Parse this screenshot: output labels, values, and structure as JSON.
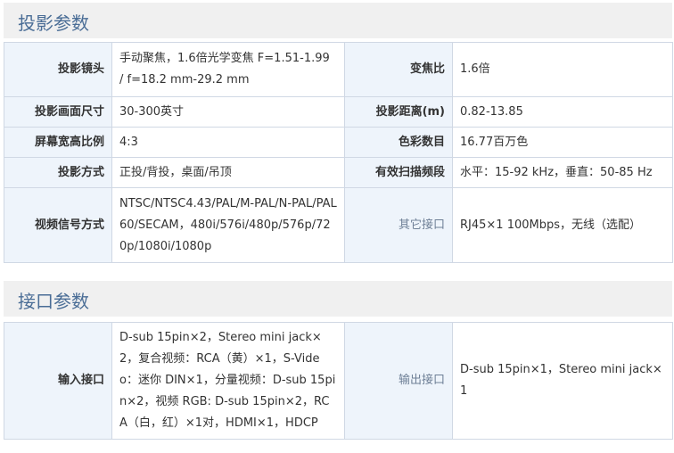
{
  "sections": [
    {
      "title": "投影参数",
      "rows": [
        [
          {
            "label": "投影镜头",
            "value": "手动聚焦，1.6倍光学变焦 F=1.51-1.99 / f=18.2 mm-29.2 mm"
          },
          {
            "label": "变焦比",
            "value": "1.6倍"
          }
        ],
        [
          {
            "label": "投影画面尺寸",
            "value": "30-300英寸"
          },
          {
            "label": "投影距离(m)",
            "value": "0.82-13.85"
          }
        ],
        [
          {
            "label": "屏幕宽高比例",
            "value": "4:3"
          },
          {
            "label": "色彩数目",
            "value": "16.77百万色"
          }
        ],
        [
          {
            "label": "投影方式",
            "value": "正投/背投，桌面/吊顶"
          },
          {
            "label": "有效扫描频段",
            "value": "水平：15-92 kHz，垂直：50-85 Hz"
          }
        ],
        [
          {
            "label": "视频信号方式",
            "value": "NTSC/NTSC4.43/PAL/M-PAL/N-PAL/PAL60/SECAM，480i/576i/480p/576p/720p/1080i/1080p"
          },
          {
            "label": "其它接口",
            "value": "RJ45×1 100Mbps，无线（选配）"
          }
        ]
      ]
    },
    {
      "title": "接口参数",
      "rows": [
        [
          {
            "label": "输入接口",
            "value": "D-sub 15pin×2，Stereo mini jack×2，复合视频：RCA（黄）×1，S-Video：迷你 DIN×1，分量视频：D-sub 15pin×2，视频 RGB: D-sub 15pin×2，RCA（白，红）×1对，HDMI×1，HDCP"
          },
          {
            "label": "输出接口",
            "value": "D-sub 15pin×1，Stereo mini jack×1"
          }
        ]
      ]
    }
  ]
}
